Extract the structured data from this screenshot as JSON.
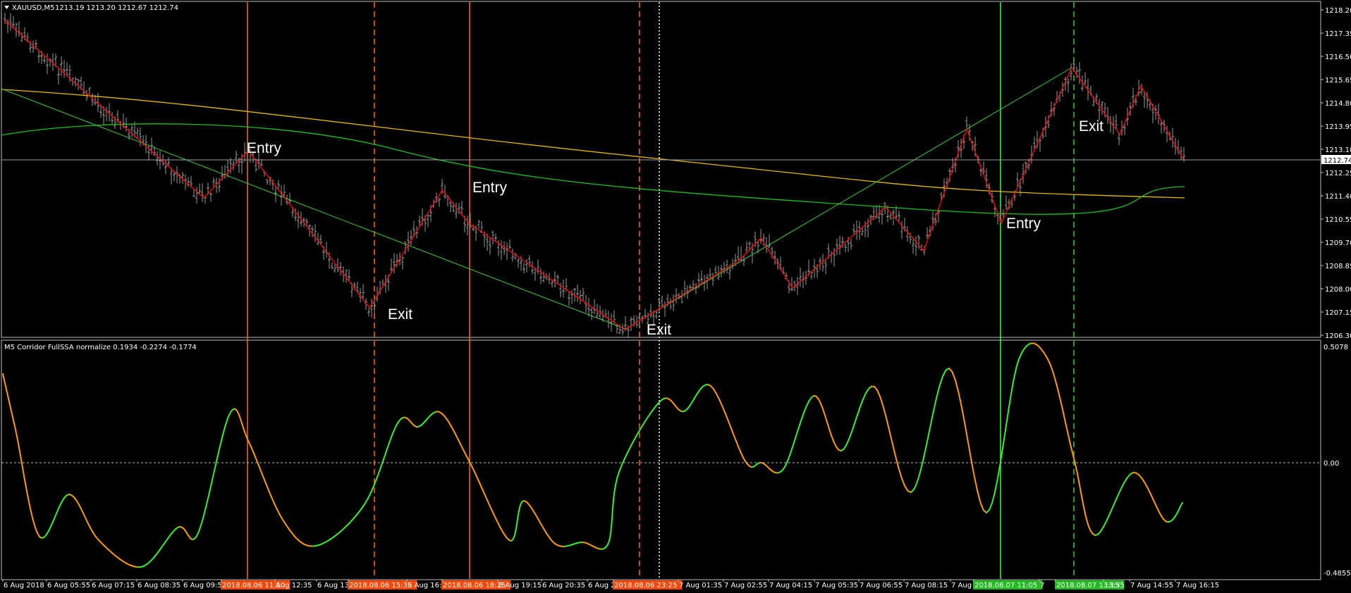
{
  "colors": {
    "background": "#000000",
    "frame": "#c0c0c0",
    "zigzag": "#ff0000",
    "ma_yellow": "#e6b800",
    "ma_green": "#19c219",
    "trend_green": "#33cc33",
    "entry_sell_line": "#ff6a00",
    "exit_sell_line": "#ff6a00",
    "entry_buy_line": "#33ff33",
    "exit_buy_line": "#33cc33",
    "osc_up": "#33ee33",
    "osc_down": "#ff9900",
    "label_sell_bg": "#ff4500",
    "label_buy_bg": "#22bb22"
  },
  "main_header": {
    "menu_icon": "triangle-down-icon",
    "symbol": "XAUUSD,M5",
    "ohlc": "1213.19 1213.20 1212.67 1212.74"
  },
  "price_axis": {
    "ticks": [
      "1218.20",
      "1217.35",
      "1216.50",
      "1215.65",
      "1214.80",
      "1213.95",
      "1213.10",
      "1212.25",
      "1211.40",
      "1210.55",
      "1209.70",
      "1208.85",
      "1208.00",
      "1207.15",
      "1206.30"
    ],
    "current_price": "1212.74"
  },
  "indicator_header": "M5 Corridor FullSSA normalize 0.1934 -0.2274 -0.1774",
  "indicator_axis": {
    "top": "0.5078",
    "zero": "0.00",
    "bottom": "-0.4855"
  },
  "annotations": [
    {
      "text": "Entry"
    },
    {
      "text": "Exit"
    },
    {
      "text": "Entry"
    },
    {
      "text": "Exit"
    },
    {
      "text": "Entry"
    },
    {
      "text": "Exit"
    }
  ],
  "time_axis": [
    {
      "text": "6 Aug 2018"
    },
    {
      "text": "6 Aug 05:55"
    },
    {
      "text": "6 Aug 07:15"
    },
    {
      "text": "6 Aug 08:35"
    },
    {
      "text": "6 Aug 09:55"
    },
    {
      "text": "2018.08.06 11:50",
      "highlight": "sell"
    },
    {
      "text": "Aug 12:35"
    },
    {
      "text": "6 Aug 13:"
    },
    {
      "text": "2018.08.06 15:35",
      "highlight": "sell"
    },
    {
      "text": "6 Aug 16:35"
    },
    {
      "text": "2018.08.06 18:25",
      "highlight": "sell"
    },
    {
      "text": "6 Aug 19:15"
    },
    {
      "text": "6 Aug 20:35"
    },
    {
      "text": "6 Aug 2"
    },
    {
      "text": "2018.08.06 23:25",
      "highlight": "sell"
    },
    {
      "text": "7 Aug 01:35"
    },
    {
      "text": "7 Aug 02:55"
    },
    {
      "text": "7 Aug 04:15"
    },
    {
      "text": "7 Aug 05:35"
    },
    {
      "text": "7 Aug 06:55"
    },
    {
      "text": "7 Aug 08:15"
    },
    {
      "text": "7 Aug 0"
    },
    {
      "text": "2018.08.07 11:05",
      "highlight": "buy"
    },
    {
      "text": "7"
    },
    {
      "text": "2018.08.07 13:15",
      "highlight": "buy"
    },
    {
      "text": "13:35"
    },
    {
      "text": "7 Aug 14:55"
    },
    {
      "text": "7 Aug 16:15"
    }
  ]
}
